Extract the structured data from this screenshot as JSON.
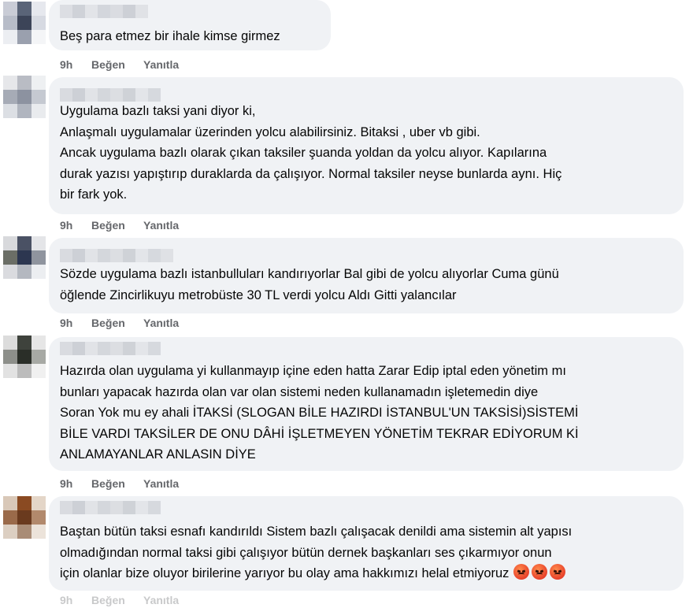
{
  "actions": {
    "time": "9h",
    "like": "Beğen",
    "reply": "Yanıtla"
  },
  "comments": [
    {
      "lines": [
        "Beş para etmez bir ihale kimse girmez"
      ],
      "time": "9h",
      "like": "Beğen",
      "reply": "Yanıtla"
    },
    {
      "lines": [
        "Uygulama bazlı taksi yani diyor ki,",
        "Anlaşmalı uygulamalar üzerinden yolcu alabilirsiniz. Bitaksi , uber vb gibi.",
        "Ancak uygulama bazlı olarak çıkan taksiler şuanda yoldan da yolcu alıyor. Kapılarına",
        "durak yazısı yapıştırıp duraklarda da çalışıyor. Normal taksiler neyse bunlarda aynı. Hiç",
        "bir fark yok."
      ],
      "time": "9h",
      "like": "Beğen",
      "reply": "Yanıtla"
    },
    {
      "lines": [
        "Sözde uygulama bazlı istanbulluları kandırıyorlar Bal gibi de yolcu alıyorlar Cuma günü",
        "öğlende Zincirlikuyu metrobüste 30 TL verdi yolcu Aldı Gitti yalancılar"
      ],
      "time": "9h",
      "like": "Beğen",
      "reply": "Yanıtla"
    },
    {
      "lines": [
        "Hazırda olan uygulama yi kullanmayıp içine eden hatta Zarar Edip iptal eden yönetim mı",
        "bunları yapacak hazırda olan var olan sistemi neden kullanamadın işletemedin diye",
        "Soran Yok mu ey ahali İTAKSİ (SLOGAN BİLE HAZIRDI İSTANBUL'UN TAKSİSİ)SİSTEMİ",
        "BİLE VARDI TAKSİLER DE ONU DÂHİ İŞLETMEYEN YÖNETİM TEKRAR EDİYORUM Kİ",
        "ANLAMAYANLAR ANLASIN DİYE"
      ],
      "time": "9h",
      "like": "Beğen",
      "reply": "Yanıtla"
    },
    {
      "lines": [
        "Baştan bütün taksi esnafı kandırıldı Sistem bazlı çalışacak denildi ama sistemin alt yapısı",
        "olmadığından normal taksi gibi çalışıyor bütün dernek başkanları ses çıkarmıyor onun",
        "için olanlar bize oluyor birilerine yarıyor bu olay ama hakkımızı helal etmiyoruz"
      ],
      "emoji_names": [
        "angry-face-icon",
        "angry-face-icon",
        "angry-face-icon"
      ]
    }
  ],
  "colors": {
    "bubble_bg": "#f0f2f5",
    "meta_text": "#65676b",
    "body_text": "#050505"
  }
}
